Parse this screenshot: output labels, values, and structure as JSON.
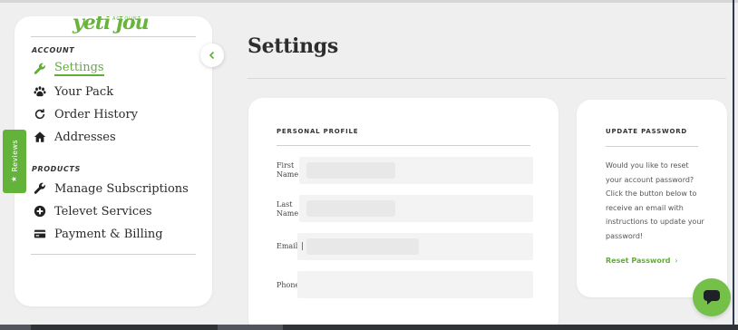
{
  "brand": {
    "logo_text": "yeti jou",
    "logo_sub": "ACCOUNT"
  },
  "sidebar": {
    "sections": [
      {
        "title": "ACCOUNT",
        "items": [
          {
            "label": "Settings",
            "icon": "wrench-icon",
            "active": true
          },
          {
            "label": "Your Pack",
            "icon": "paw-icon",
            "active": false
          },
          {
            "label": "Order History",
            "icon": "refresh-icon",
            "active": false
          },
          {
            "label": "Addresses",
            "icon": "home-icon",
            "active": false
          }
        ]
      },
      {
        "title": "PRODUCTS",
        "items": [
          {
            "label": "Manage Subscriptions",
            "icon": "wrench-icon"
          },
          {
            "label": "Televet Services",
            "icon": "plus-circle-icon"
          },
          {
            "label": "Payment & Billing",
            "icon": "credit-card-icon"
          }
        ]
      }
    ]
  },
  "reviews_tab": {
    "label": "Reviews"
  },
  "header": {
    "title": "Settings"
  },
  "profile_card": {
    "title": "PERSONAL PROFILE",
    "fields": [
      {
        "label": "First\nName"
      },
      {
        "label": "Last\nName"
      },
      {
        "label": "Email"
      },
      {
        "label": "Phone"
      }
    ]
  },
  "password_card": {
    "title": "UPDATE PASSWORD",
    "description": "Would you like to reset your account password? Click the button below to receive an email with instructions to update your password!",
    "link_label": "Reset Password",
    "link_arrow": "›"
  },
  "colors": {
    "accent": "#5fae35",
    "chat": "#74c049"
  }
}
